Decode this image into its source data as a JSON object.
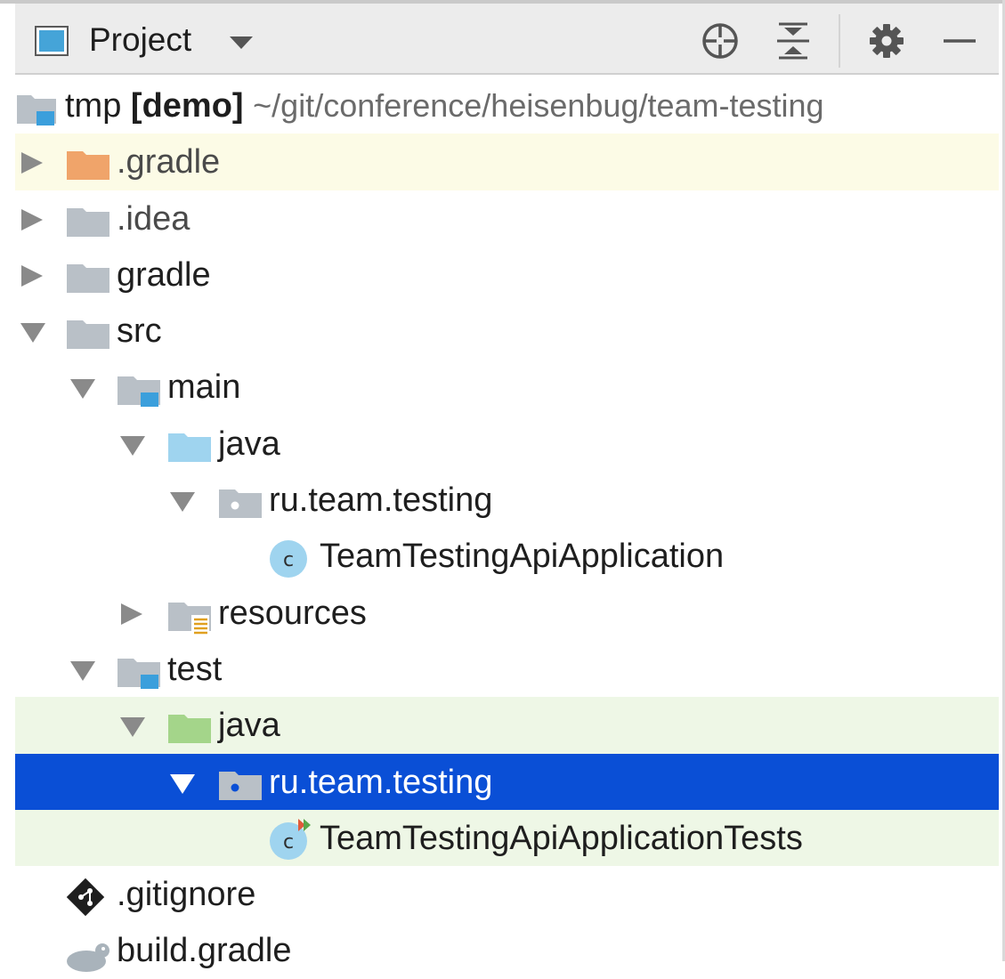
{
  "window": {
    "view_title": "Project",
    "toolbar_icons": [
      "crosshair-icon",
      "collapse-all-icon",
      "gear-icon",
      "minimize-icon"
    ]
  },
  "tree": {
    "root": {
      "name": "tmp",
      "module": "[demo]",
      "path": "~/git/conference/heisenbug/team-testing"
    },
    "items": [
      {
        "label": ".gradle",
        "icon": "folder-excluded-icon",
        "expanded": false
      },
      {
        "label": ".idea",
        "icon": "folder-icon",
        "expanded": false
      },
      {
        "label": "gradle",
        "icon": "folder-icon",
        "expanded": false
      },
      {
        "label": "src",
        "icon": "folder-icon",
        "expanded": true
      },
      {
        "label": "main",
        "icon": "module-folder-icon",
        "expanded": true
      },
      {
        "label": "java",
        "icon": "source-root-icon",
        "expanded": true
      },
      {
        "label": "ru.team.testing",
        "icon": "package-icon",
        "expanded": true
      },
      {
        "label": "TeamTestingApiApplication",
        "icon": "class-icon"
      },
      {
        "label": "resources",
        "icon": "resources-folder-icon",
        "expanded": false
      },
      {
        "label": "test",
        "icon": "module-folder-icon",
        "expanded": true
      },
      {
        "label": "java",
        "icon": "test-root-icon",
        "expanded": true
      },
      {
        "label": "ru.team.testing",
        "icon": "package-icon",
        "expanded": true,
        "selected": true
      },
      {
        "label": "TeamTestingApiApplicationTests",
        "icon": "test-class-icon"
      },
      {
        "label": ".gitignore",
        "icon": "git-icon"
      },
      {
        "label": "build.gradle",
        "icon": "gradle-icon"
      }
    ]
  },
  "colors": {
    "selection": "#0a4fd6",
    "excluded_highlight": "#fcfbe6",
    "test_highlight": "#eef7e6",
    "folder": "#b9c0c7",
    "excluded_folder": "#f0a46a",
    "source_root": "#9fd4ef",
    "test_root": "#a4d58a",
    "class_badge": "#9fd4ef"
  }
}
